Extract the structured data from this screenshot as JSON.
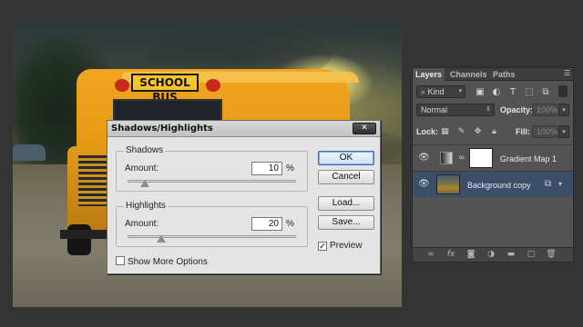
{
  "canvas": {
    "bus_sign": "SCHOOL BUS"
  },
  "dialog": {
    "title": "Shadows/Highlights",
    "close_icon": "close-icon",
    "shadows": {
      "group_label": "Shadows",
      "amount_label": "Amount:",
      "amount_value": "10",
      "unit": "%",
      "slider_fraction": 0.1
    },
    "highlights": {
      "group_label": "Highlights",
      "amount_label": "Amount:",
      "amount_value": "20",
      "unit": "%",
      "slider_fraction": 0.2
    },
    "show_more_label": "Show More Options",
    "show_more_checked": false,
    "buttons": {
      "ok": "OK",
      "cancel": "Cancel",
      "load": "Load...",
      "save": "Save..."
    },
    "preview_label": "Preview",
    "preview_checked": true
  },
  "panel": {
    "tabs": [
      "Layers",
      "Channels",
      "Paths"
    ],
    "active_tab": "Layers",
    "filter_kind": "Kind",
    "blend_mode": "Normal",
    "opacity_label": "Opacity:",
    "opacity_value": "100%",
    "lock_label": "Lock:",
    "fill_label": "Fill:",
    "fill_value": "100%",
    "layers": [
      {
        "name": "Gradient Map 1",
        "type": "adjustment",
        "selected": false,
        "thumb_color": "#ffffff"
      },
      {
        "name": "Background copy",
        "type": "pixel",
        "selected": true,
        "thumb_color": "#5a6a74"
      }
    ],
    "footer_icons": [
      "link-icon",
      "fx-icon",
      "mask-icon",
      "adjustment-icon",
      "folder-icon",
      "new-layer-icon",
      "trash-icon"
    ]
  }
}
